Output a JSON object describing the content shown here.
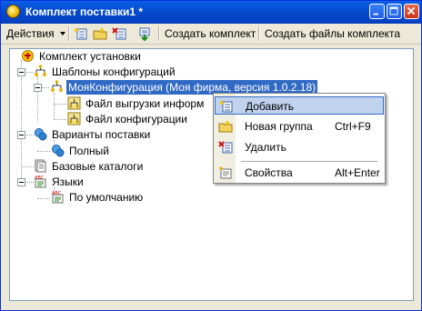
{
  "window": {
    "title": "Комплект поставки1 *"
  },
  "toolbar": {
    "actions_label": "Действия",
    "create_kit_label": "Создать комплект",
    "create_kit_files_label": "Создать файлы комплекта"
  },
  "tree": {
    "root": "Комплект установки",
    "config_templates": "Шаблоны конфигураций",
    "my_config": "МояКонфигурация (Моя фирма, версия 1.0.2.18)",
    "upload_file": "Файл выгрузки информ",
    "config_file": "Файл конфигурации",
    "delivery_variants": "Варианты поставки",
    "full": "Полный",
    "base_catalogs": "Базовые каталоги",
    "languages": "Языки",
    "default": "По умолчанию"
  },
  "context_menu": {
    "add": "Добавить",
    "new_group": "Новая группа",
    "new_group_shortcut": "Ctrl+F9",
    "delete": "Удалить",
    "properties": "Свойства",
    "properties_shortcut": "Alt+Enter"
  }
}
